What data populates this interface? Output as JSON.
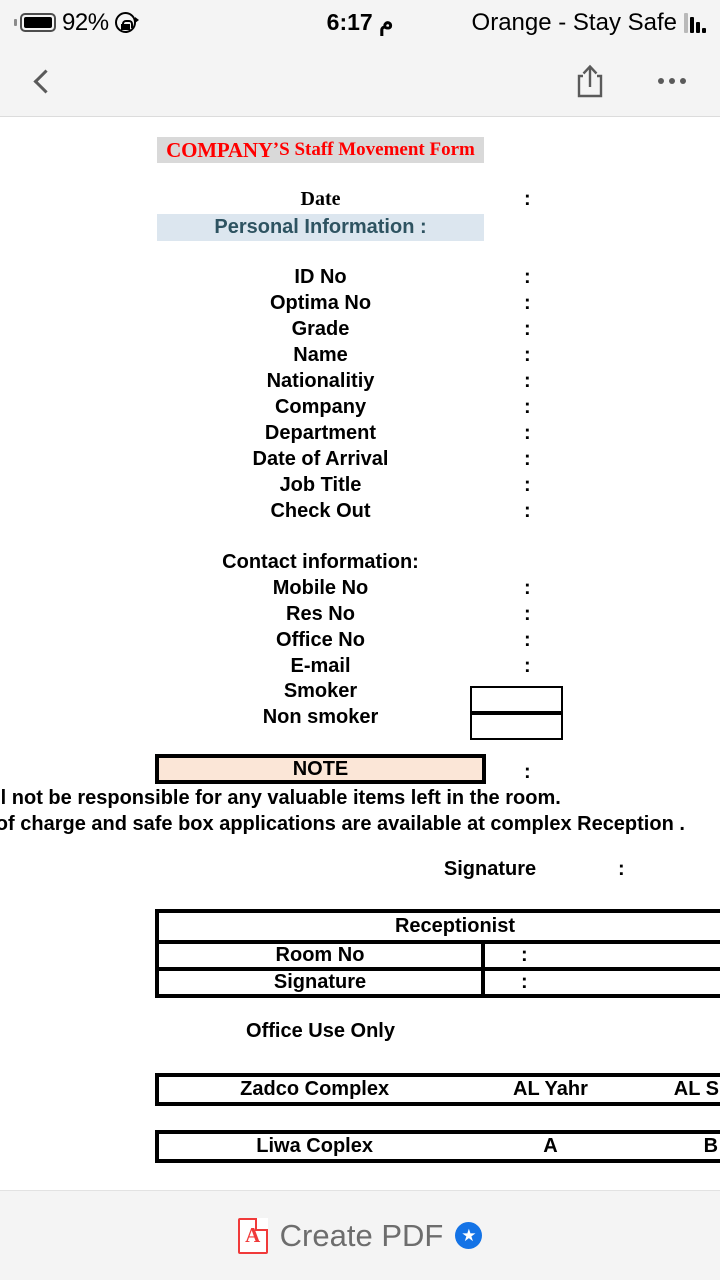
{
  "status_bar": {
    "battery_percent": "92%",
    "battery_icon": "battery-full-icon",
    "rotation_lock_icon": "rotation-lock-icon",
    "time": "م 6:17",
    "carrier": "Orange - Stay Safe",
    "signal_icon": "signal-bars-icon"
  },
  "toolbar": {
    "back_icon": "chevron-left-icon",
    "share_icon": "share-icon",
    "more_icon": "more-horizontal-icon"
  },
  "document": {
    "title_main": "COMPANY",
    "title_rest": "’S Staff Movement Form",
    "date_label": "Date",
    "date_colon": ":",
    "personal_information_header": "Personal Information :",
    "fields": [
      {
        "label": "ID No",
        "colon": ":"
      },
      {
        "label": "Optima No",
        "colon": ":"
      },
      {
        "label": "Grade",
        "colon": ":"
      },
      {
        "label": "Name",
        "colon": ":"
      },
      {
        "label": "Nationalitiy",
        "colon": ":"
      },
      {
        "label": "Company",
        "colon": ":"
      },
      {
        "label": "Department",
        "colon": ":"
      },
      {
        "label": "Date of Arrival",
        "colon": ":"
      },
      {
        "label": "Job Title",
        "colon": ":"
      },
      {
        "label": "Check Out",
        "colon": ":"
      }
    ],
    "contact_header": "Contact information:",
    "contact_fields": [
      {
        "label": "Mobile No",
        "colon": ":"
      },
      {
        "label": "Res No",
        "colon": ":"
      },
      {
        "label": "Office No",
        "colon": ":"
      },
      {
        "label": "E-mail",
        "colon": ":"
      }
    ],
    "smoker_label": "Smoker",
    "non_smoker_label": "Non smoker",
    "note_label": "NOTE",
    "note_colon": ":",
    "note_line_1": "will not be responsible for any valuable items left in the room.",
    "note_line_2": "ee of charge and safe box applications are available at complex Reception .",
    "signature_label": "Signature",
    "signature_colon": ":",
    "receptionist_table": {
      "header": "Receptionist",
      "rows": [
        {
          "label": "Room No",
          "value": ":"
        },
        {
          "label": "Signature",
          "value": ":"
        }
      ]
    },
    "office_use_label": "Office Use Only",
    "office_tables": [
      {
        "c1": "Zadco Complex",
        "c2": "AL Yahr",
        "c3": "AL Sula"
      },
      {
        "c1": "Liwa Coplex",
        "c2": "A",
        "c3": "B"
      }
    ]
  },
  "bottom_bar": {
    "pdf_icon": "adobe-pdf-icon",
    "pdf_glyph": "A",
    "create_pdf_label": "Create PDF",
    "premium_badge_icon": "star-badge-icon",
    "premium_badge_glyph": "★"
  },
  "colors": {
    "title_red": "#ff0000",
    "title_band": "#d9d9d9",
    "personal_band": "#dce6ef",
    "personal_text": "#2e5361",
    "note_fill": "#fbe6d7",
    "chrome_gray": "#f4f4f4",
    "badge_blue": "#1473e6",
    "pdf_red": "#f03a3a"
  }
}
